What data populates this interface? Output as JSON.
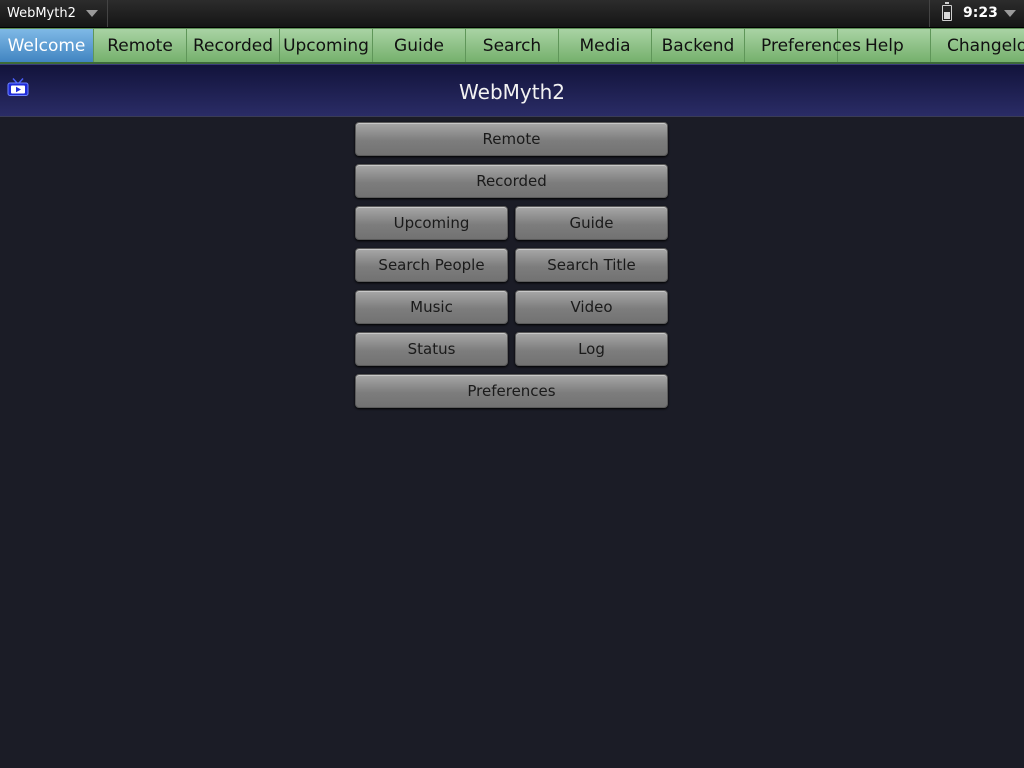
{
  "status_bar": {
    "app_name": "WebMyth2",
    "time": "9:23"
  },
  "tabs": [
    {
      "label": "Welcome",
      "active": true
    },
    {
      "label": "Remote",
      "active": false
    },
    {
      "label": "Recorded",
      "active": false
    },
    {
      "label": "Upcoming",
      "active": false
    },
    {
      "label": "Guide",
      "active": false
    },
    {
      "label": "Search",
      "active": false
    },
    {
      "label": "Media",
      "active": false
    },
    {
      "label": "Backend",
      "active": false
    },
    {
      "label": "Preferences",
      "active": false
    },
    {
      "label": "Help",
      "active": false
    },
    {
      "label": "Changelog",
      "active": false
    }
  ],
  "header": {
    "title": "WebMyth2",
    "icon": "tv-play-icon"
  },
  "buttons": {
    "remote": "Remote",
    "recorded": "Recorded",
    "upcoming": "Upcoming",
    "guide": "Guide",
    "search_people": "Search People",
    "search_title": "Search Title",
    "music": "Music",
    "video": "Video",
    "status": "Status",
    "log": "Log",
    "preferences": "Preferences"
  },
  "colors": {
    "background": "#1b1c26",
    "tab_bar": "#8cc485",
    "tab_active": "#4f94cf",
    "header": "#1c1d4f",
    "button": "#8a8a8a"
  }
}
